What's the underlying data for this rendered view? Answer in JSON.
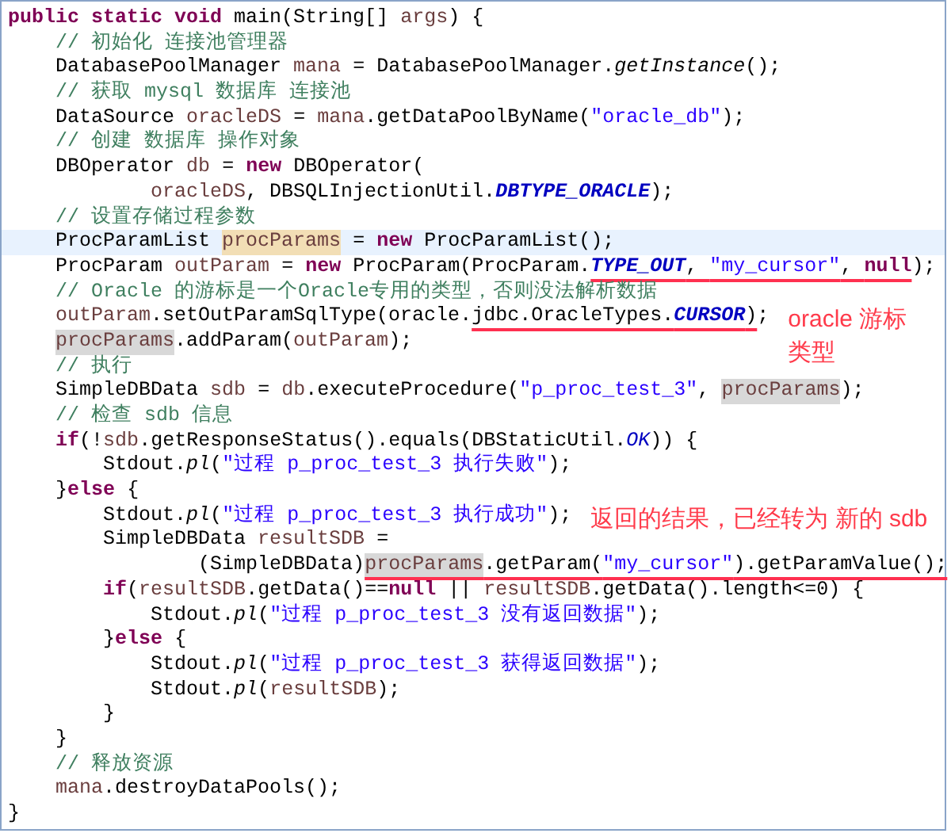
{
  "lines": [
    {
      "current": false,
      "tokens": [
        {
          "kind": "kw",
          "text": "public static void"
        },
        {
          "kind": "plain",
          "text": " main(String[] "
        },
        {
          "kind": "var",
          "text": "args"
        },
        {
          "kind": "plain",
          "text": ") {"
        }
      ]
    },
    {
      "current": false,
      "tokens": [
        {
          "kind": "comment",
          "text": "    // 初始化 连接池管理器"
        }
      ]
    },
    {
      "current": false,
      "tokens": [
        {
          "kind": "plain",
          "text": "    DatabasePoolManager "
        },
        {
          "kind": "var",
          "text": "mana"
        },
        {
          "kind": "plain",
          "text": " = DatabasePoolManager."
        },
        {
          "kind": "static",
          "text": "getInstance"
        },
        {
          "kind": "plain",
          "text": "();"
        }
      ]
    },
    {
      "current": false,
      "tokens": [
        {
          "kind": "comment",
          "text": "    // 获取 mysql 数据库 连接池"
        }
      ]
    },
    {
      "current": false,
      "tokens": [
        {
          "kind": "plain",
          "text": "    DataSource "
        },
        {
          "kind": "var",
          "text": "oracleDS"
        },
        {
          "kind": "plain",
          "text": " = "
        },
        {
          "kind": "var",
          "text": "mana"
        },
        {
          "kind": "plain",
          "text": ".getDataPoolByName("
        },
        {
          "kind": "str",
          "text": "\"oracle_db\""
        },
        {
          "kind": "plain",
          "text": ");"
        }
      ]
    },
    {
      "current": false,
      "tokens": [
        {
          "kind": "comment",
          "text": "    // 创建 数据库 操作对象"
        }
      ]
    },
    {
      "current": false,
      "tokens": [
        {
          "kind": "plain",
          "text": "    DBOperator "
        },
        {
          "kind": "var",
          "text": "db"
        },
        {
          "kind": "plain",
          "text": " = "
        },
        {
          "kind": "kw",
          "text": "new"
        },
        {
          "kind": "plain",
          "text": " DBOperator("
        }
      ]
    },
    {
      "current": false,
      "tokens": [
        {
          "kind": "var",
          "text": "            oracleDS"
        },
        {
          "kind": "plain",
          "text": ", DBSQLInjectionUtil."
        },
        {
          "kind": "const",
          "text": "DBTYPE_ORACLE"
        },
        {
          "kind": "plain",
          "text": ");"
        }
      ]
    },
    {
      "current": false,
      "tokens": [
        {
          "kind": "comment",
          "text": "    // 设置存储过程参数"
        }
      ]
    },
    {
      "current": true,
      "tokens": [
        {
          "kind": "plain",
          "text": "    ProcParamList "
        },
        {
          "kind": "occ-write",
          "text": "procParams"
        },
        {
          "kind": "plain",
          "text": " = "
        },
        {
          "kind": "kw",
          "text": "new"
        },
        {
          "kind": "plain",
          "text": " ProcParamList();"
        }
      ]
    },
    {
      "current": false,
      "tokens": [
        {
          "kind": "plain",
          "text": "    ProcParam "
        },
        {
          "kind": "var",
          "text": "outParam"
        },
        {
          "kind": "plain",
          "text": " = "
        },
        {
          "kind": "kw",
          "text": "new"
        },
        {
          "kind": "plain",
          "text": " ProcParam(ProcParam."
        },
        {
          "kind": "const",
          "text": "TYPE_OUT",
          "underlined": true
        },
        {
          "kind": "plain",
          "text": ", ",
          "underlined": true
        },
        {
          "kind": "str",
          "text": "\"my_cursor\"",
          "underlined": true
        },
        {
          "kind": "plain",
          "text": ", ",
          "underlined": true
        },
        {
          "kind": "kw",
          "text": "null",
          "underlined": true
        },
        {
          "kind": "plain",
          "text": ");"
        }
      ]
    },
    {
      "current": false,
      "tokens": [
        {
          "kind": "comment",
          "text": "    // Oracle 的游标是一个Oracle专用的类型，否则没法解析数据"
        }
      ]
    },
    {
      "current": false,
      "note": "oracle 游标类型",
      "tokens": [
        {
          "kind": "var",
          "text": "    outParam"
        },
        {
          "kind": "plain",
          "text": ".setOutParamSqlType(oracle."
        },
        {
          "kind": "plain",
          "text": "jdbc.OracleTypes.",
          "underlined": true
        },
        {
          "kind": "const",
          "text": "CURSOR",
          "underlined": true
        },
        {
          "kind": "plain",
          "text": ")",
          "underlined": true
        },
        {
          "kind": "plain",
          "text": ";"
        }
      ]
    },
    {
      "current": false,
      "tokens": [
        {
          "kind": "occ-read",
          "text": "    procParams"
        },
        {
          "kind": "plain",
          "text": ".addParam("
        },
        {
          "kind": "var",
          "text": "outParam"
        },
        {
          "kind": "plain",
          "text": ");"
        }
      ]
    },
    {
      "current": false,
      "tokens": [
        {
          "kind": "comment",
          "text": "    // 执行"
        }
      ]
    },
    {
      "current": false,
      "tokens": [
        {
          "kind": "plain",
          "text": "    SimpleDBData "
        },
        {
          "kind": "var",
          "text": "sdb"
        },
        {
          "kind": "plain",
          "text": " = "
        },
        {
          "kind": "var",
          "text": "db"
        },
        {
          "kind": "plain",
          "text": ".executeProcedure("
        },
        {
          "kind": "str",
          "text": "\"p_proc_test_3\""
        },
        {
          "kind": "plain",
          "text": ", "
        },
        {
          "kind": "occ-read",
          "text": "procParams"
        },
        {
          "kind": "plain",
          "text": ");"
        }
      ]
    },
    {
      "current": false,
      "tokens": [
        {
          "kind": "comment",
          "text": "    // 检查 sdb 信息"
        }
      ]
    },
    {
      "current": false,
      "tokens": [
        {
          "kind": "kw",
          "text": "    if"
        },
        {
          "kind": "plain",
          "text": "(!"
        },
        {
          "kind": "var",
          "text": "sdb"
        },
        {
          "kind": "plain",
          "text": ".getResponseStatus().equals(DBStaticUtil."
        },
        {
          "kind": "static-field",
          "text": "OK"
        },
        {
          "kind": "plain",
          "text": ")) {"
        }
      ]
    },
    {
      "current": false,
      "tokens": [
        {
          "kind": "plain",
          "text": "        Stdout."
        },
        {
          "kind": "static",
          "text": "pl"
        },
        {
          "kind": "plain",
          "text": "("
        },
        {
          "kind": "str",
          "text": "\"过程 p_proc_test_3 执行失败\""
        },
        {
          "kind": "plain",
          "text": ");"
        }
      ]
    },
    {
      "current": false,
      "tokens": [
        {
          "kind": "plain",
          "text": "    }"
        },
        {
          "kind": "kw",
          "text": "else"
        },
        {
          "kind": "plain",
          "text": " {"
        }
      ]
    },
    {
      "current": false,
      "note": "返回的结果，已经转为 新的 sdb",
      "tokens": [
        {
          "kind": "plain",
          "text": "        Stdout."
        },
        {
          "kind": "static",
          "text": "pl"
        },
        {
          "kind": "plain",
          "text": "("
        },
        {
          "kind": "str",
          "text": "\"过程 p_proc_test_3 执行成功\""
        },
        {
          "kind": "plain",
          "text": ");"
        }
      ]
    },
    {
      "current": false,
      "tokens": [
        {
          "kind": "plain",
          "text": "        SimpleDBData "
        },
        {
          "kind": "var",
          "text": "resultSDB"
        },
        {
          "kind": "plain",
          "text": " ="
        }
      ]
    },
    {
      "current": false,
      "tokens": [
        {
          "kind": "plain",
          "text": "                (SimpleDBData)"
        },
        {
          "kind": "occ-read",
          "text": "procParams",
          "underlined": true
        },
        {
          "kind": "plain",
          "text": ".getParam(",
          "underlined": true
        },
        {
          "kind": "str",
          "text": "\"my_cursor\"",
          "underlined": true
        },
        {
          "kind": "plain",
          "text": ").getParamValue();",
          "underlined": true
        }
      ]
    },
    {
      "current": false,
      "tokens": [
        {
          "kind": "kw",
          "text": "        if"
        },
        {
          "kind": "plain",
          "text": "("
        },
        {
          "kind": "var",
          "text": "resultSDB"
        },
        {
          "kind": "plain",
          "text": ".getData()=="
        },
        {
          "kind": "kw",
          "text": "null"
        },
        {
          "kind": "plain",
          "text": " || "
        },
        {
          "kind": "var",
          "text": "resultSDB"
        },
        {
          "kind": "plain",
          "text": ".getData().length<=0) {"
        }
      ]
    },
    {
      "current": false,
      "tokens": [
        {
          "kind": "plain",
          "text": "            Stdout."
        },
        {
          "kind": "static",
          "text": "pl"
        },
        {
          "kind": "plain",
          "text": "("
        },
        {
          "kind": "str",
          "text": "\"过程 p_proc_test_3 没有返回数据\""
        },
        {
          "kind": "plain",
          "text": ");"
        }
      ]
    },
    {
      "current": false,
      "tokens": [
        {
          "kind": "plain",
          "text": "        }"
        },
        {
          "kind": "kw",
          "text": "else"
        },
        {
          "kind": "plain",
          "text": " {"
        }
      ]
    },
    {
      "current": false,
      "tokens": [
        {
          "kind": "plain",
          "text": "            Stdout."
        },
        {
          "kind": "static",
          "text": "pl"
        },
        {
          "kind": "plain",
          "text": "("
        },
        {
          "kind": "str",
          "text": "\"过程 p_proc_test_3 获得返回数据\""
        },
        {
          "kind": "plain",
          "text": ");"
        }
      ]
    },
    {
      "current": false,
      "tokens": [
        {
          "kind": "plain",
          "text": "            Stdout."
        },
        {
          "kind": "static",
          "text": "pl"
        },
        {
          "kind": "plain",
          "text": "("
        },
        {
          "kind": "var",
          "text": "resultSDB"
        },
        {
          "kind": "plain",
          "text": ");"
        }
      ]
    },
    {
      "current": false,
      "tokens": [
        {
          "kind": "plain",
          "text": "        }"
        }
      ]
    },
    {
      "current": false,
      "tokens": [
        {
          "kind": "plain",
          "text": "    }"
        }
      ]
    },
    {
      "current": false,
      "tokens": [
        {
          "kind": "comment",
          "text": "    // 释放资源"
        }
      ]
    },
    {
      "current": false,
      "tokens": [
        {
          "kind": "var",
          "text": "    mana"
        },
        {
          "kind": "plain",
          "text": ".destroyDataPools();"
        }
      ]
    },
    {
      "current": false,
      "tokens": [
        {
          "kind": "plain",
          "text": "}"
        }
      ]
    }
  ]
}
